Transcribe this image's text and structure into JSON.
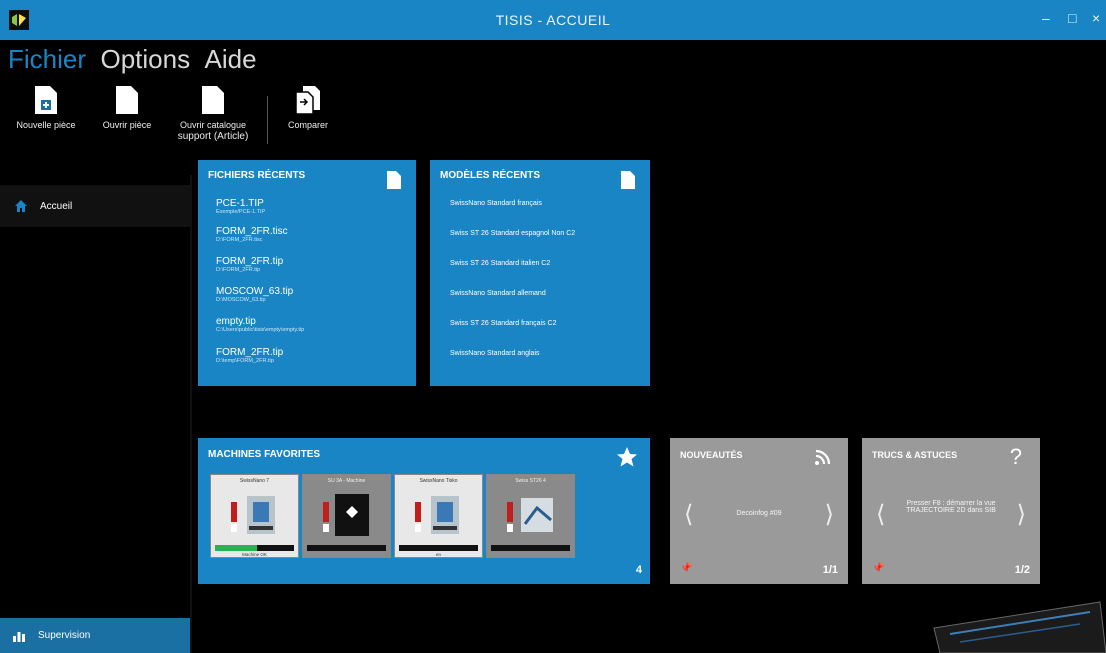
{
  "window": {
    "title": "TISIS - ACCUEIL",
    "minimize": "–",
    "maximize": "□",
    "close": "×"
  },
  "menu": {
    "items": [
      "Fichier",
      "Options",
      "Aide"
    ]
  },
  "ribbon": {
    "new_part": "Nouvelle pièce",
    "open_part": "Ouvrir pièce",
    "open_catalog_1": "Ouvrir catalogue",
    "open_catalog_2": "support (Article)",
    "compare": "Comparer"
  },
  "sidebar": {
    "home": "Accueil",
    "supervision": "Supervision"
  },
  "recent_files": {
    "title": "FICHIERS RÉCENTS",
    "items": [
      {
        "name": "PCE-1.TIP",
        "path": "Exemple/PCE-1.TIP"
      },
      {
        "name": "FORM_2FR.tisc",
        "path": "D:\\FORM_2FR.tisc"
      },
      {
        "name": "FORM_2FR.tip",
        "path": "D:\\FORM_2FR.tip"
      },
      {
        "name": "MOSCOW_63.tip",
        "path": "D:\\MOSCOW_63.tip"
      },
      {
        "name": "empty.tip",
        "path": "C:\\Users\\public\\tisis\\empty\\empty.tip"
      },
      {
        "name": "FORM_2FR.tip",
        "path": "D:\\temp\\FORM_2FR.tip"
      }
    ]
  },
  "recent_models": {
    "title": "MODÈLES RÉCENTS",
    "items": [
      "SwissNano Standard français",
      "Swiss ST 26 Standard espagnol Non C2",
      "Swiss ST 26 Standard italien C2",
      "SwissNano Standard allemand",
      "Swiss ST 26 Standard français C2",
      "SwissNano Standard anglais"
    ]
  },
  "favorites": {
    "title": "MACHINES FAVORITES",
    "count": "4",
    "cards": [
      {
        "caption": "SwissNano 7",
        "status": "Machine OK"
      },
      {
        "caption": "SU 3A - Machine",
        "status": ""
      },
      {
        "caption": "SwissNano Tisko",
        "status": "en"
      },
      {
        "caption": "Swiss ST26 4",
        "status": ""
      }
    ]
  },
  "news": {
    "title": "NOUVEAUTÉS",
    "text": "Decoinfog #09",
    "page": "1/1"
  },
  "tips": {
    "title": "TRUCS & ASTUCES",
    "text": "Presser F8 : démarrer la vue TRAJECTOIRE 2D dans SIB",
    "page": "1/2"
  }
}
